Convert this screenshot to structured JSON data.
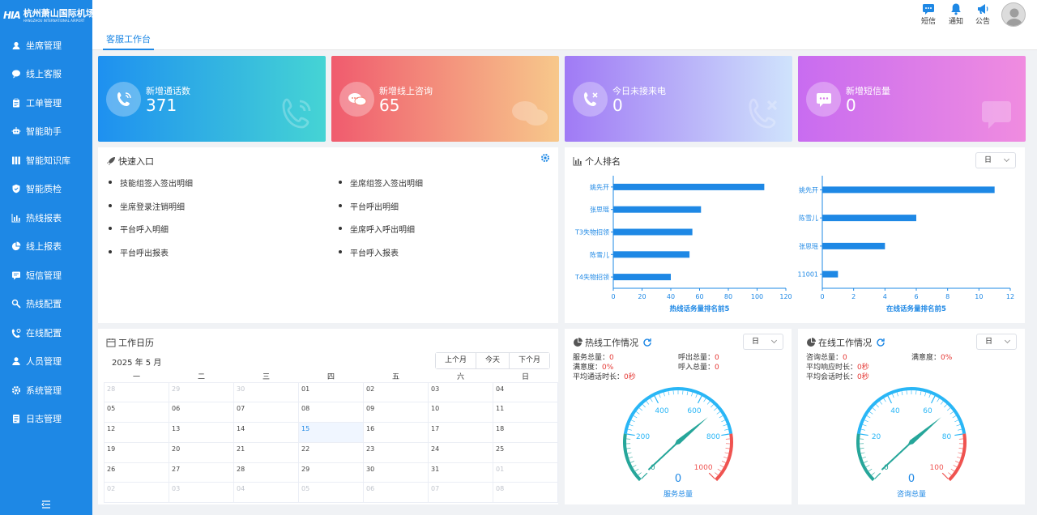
{
  "brand": {
    "mark": "HIA",
    "name_cn": "杭州萧山国际机场",
    "name_en": "HANGZHOU INTERNATIONAL AIRPORT"
  },
  "sidebar": {
    "items": [
      {
        "label": "坐席管理",
        "icon": "user-headset-icon"
      },
      {
        "label": "线上客服",
        "icon": "chat-bubble-icon"
      },
      {
        "label": "工单管理",
        "icon": "clipboard-icon"
      },
      {
        "label": "智能助手",
        "icon": "robot-icon"
      },
      {
        "label": "智能知识库",
        "icon": "library-icon"
      },
      {
        "label": "智能质检",
        "icon": "shield-check-icon"
      },
      {
        "label": "热线报表",
        "icon": "bar-chart-icon"
      },
      {
        "label": "线上报表",
        "icon": "pie-chart-icon"
      },
      {
        "label": "短信管理",
        "icon": "message-icon"
      },
      {
        "label": "热线配置",
        "icon": "phone-settings-icon"
      },
      {
        "label": "在线配置",
        "icon": "chat-settings-icon"
      },
      {
        "label": "人员管理",
        "icon": "people-icon"
      },
      {
        "label": "系统管理",
        "icon": "gear-icon"
      },
      {
        "label": "日志管理",
        "icon": "log-icon"
      }
    ]
  },
  "header": {
    "actions": [
      {
        "label": "短信",
        "icon": "sms-icon"
      },
      {
        "label": "通知",
        "icon": "bell-icon"
      },
      {
        "label": "公告",
        "icon": "megaphone-icon"
      }
    ]
  },
  "tabs": [
    {
      "label": "客服工作台",
      "active": true
    }
  ],
  "stat_cards": [
    {
      "label": "新增通话数",
      "value": "371",
      "icon": "phone-icon",
      "colors": [
        "#1e90f0",
        "#45d4d4"
      ]
    },
    {
      "label": "新增线上咨询",
      "value": "65",
      "icon": "chat-icon",
      "colors": [
        "#f05b6e",
        "#f7c88b"
      ]
    },
    {
      "label": "今日未接来电",
      "value": "0",
      "icon": "missed-call-icon",
      "colors": [
        "#a07af5",
        "#cfe3fc"
      ]
    },
    {
      "label": "新增短信量",
      "value": "0",
      "icon": "sms-icon",
      "colors": [
        "#c86cf0",
        "#f08ce0"
      ]
    }
  ],
  "quick_entry": {
    "title": "快速入口",
    "items": [
      "技能组签入签出明细",
      "坐席组签入签出明细",
      "坐席登录注销明细",
      "平台呼出明细",
      "平台呼入明细",
      "坐席呼入呼出明细",
      "平台呼出报表",
      "平台呼入报表"
    ]
  },
  "ranking": {
    "title": "个人排名",
    "period": "日"
  },
  "chart_data": [
    {
      "type": "bar",
      "orientation": "horizontal",
      "title": "热线话务量排名前5",
      "categories": [
        "姚先开",
        "张思瑶",
        "T3失物招领",
        "陈雪儿",
        "T4失物招领"
      ],
      "values": [
        105,
        61,
        55,
        53,
        40
      ],
      "xlim": [
        0,
        120
      ],
      "xticks": [
        "0",
        "20",
        "40",
        "60",
        "80",
        "100",
        "120"
      ],
      "color": "#1e88e5"
    },
    {
      "type": "bar",
      "orientation": "horizontal",
      "title": "在线话务量排名前5",
      "categories": [
        "姚先开",
        "陈雪儿",
        "张思瑶",
        "11001"
      ],
      "values": [
        11,
        6,
        4,
        1
      ],
      "xlim": [
        0,
        12
      ],
      "xticks": [
        "0",
        "2",
        "4",
        "6",
        "8",
        "10",
        "12"
      ],
      "color": "#1e88e5"
    }
  ],
  "calendar": {
    "title": "工作日历",
    "month_label": "2025 年 5 月",
    "buttons": [
      "上个月",
      "今天",
      "下个月"
    ],
    "weekdays": [
      "一",
      "二",
      "三",
      "四",
      "五",
      "六",
      "日"
    ],
    "weeks": [
      [
        "28",
        "29",
        "30",
        "01",
        "02",
        "03",
        "04"
      ],
      [
        "05",
        "06",
        "07",
        "08",
        "09",
        "10",
        "11"
      ],
      [
        "12",
        "13",
        "14",
        "15",
        "16",
        "17",
        "18"
      ],
      [
        "19",
        "20",
        "21",
        "22",
        "23",
        "24",
        "25"
      ],
      [
        "26",
        "27",
        "28",
        "29",
        "30",
        "31",
        "01"
      ],
      [
        "02",
        "03",
        "04",
        "05",
        "06",
        "07",
        "08"
      ]
    ],
    "today": "15"
  },
  "hotline": {
    "title": "热线工作情况",
    "period": "日",
    "stats_left": [
      {
        "label": "服务总量：",
        "value": "0"
      },
      {
        "label": "满意度：",
        "value": "0%"
      },
      {
        "label": "平均通话时长：",
        "value": "0秒"
      }
    ],
    "stats_right": [
      {
        "label": "呼出总量：",
        "value": "0"
      },
      {
        "label": "呼入总量：",
        "value": "0"
      }
    ],
    "gauge": {
      "value": "0",
      "label": "服务总量",
      "ticks": [
        "0",
        "200",
        "400",
        "600",
        "800",
        "1000"
      ],
      "max": 1000
    }
  },
  "online": {
    "title": "在线工作情况",
    "period": "日",
    "stats_left": [
      {
        "label": "咨询总量：",
        "value": "0"
      },
      {
        "label": "平均响应时长：",
        "value": "0秒"
      },
      {
        "label": "平均会话时长：",
        "value": "0秒"
      }
    ],
    "stats_right": [
      {
        "label": "满意度：",
        "value": "0%"
      }
    ],
    "gauge": {
      "value": "0",
      "label": "咨询总量",
      "ticks": [
        "0",
        "20",
        "40",
        "60",
        "80",
        "100"
      ],
      "max": 100
    }
  }
}
